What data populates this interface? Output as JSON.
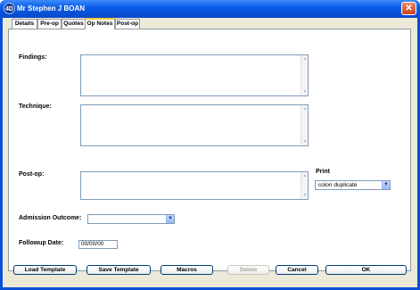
{
  "window": {
    "title": "Mr Stephen J BOAN",
    "icon": "4D"
  },
  "tabs": [
    {
      "label": "Details"
    },
    {
      "label": "Pre-op"
    },
    {
      "label": "Quotes"
    },
    {
      "label": "Op Notes"
    },
    {
      "label": "Post-op"
    }
  ],
  "active_tab": "Op Notes",
  "form": {
    "findings_label": "Findings:",
    "findings_value": "",
    "technique_label": "Technique:",
    "technique_value": "",
    "postop_label": "Post-op:",
    "postop_value": "",
    "print_label": "Print",
    "print_selected": "colon duplicate",
    "admission_label": "Admission Outcome:",
    "admission_selected": "",
    "followup_label": "Followup Date:",
    "followup_value": "00/00/00"
  },
  "buttons": {
    "load_template": "Load Template",
    "save_template": "Save Template",
    "macros": "Macros",
    "delete": "Delete",
    "cancel": "Cancel",
    "ok": "OK"
  },
  "icons": {
    "close": "close-icon",
    "dropdown": "chevron-down-icon",
    "scroll_up": "arrow-up-icon",
    "scroll_down": "arrow-down-icon"
  },
  "colors": {
    "titlebar": "#0a5ee8",
    "dialog_bg": "#ece9d8",
    "active_tab_accent": "#ffc83c"
  }
}
